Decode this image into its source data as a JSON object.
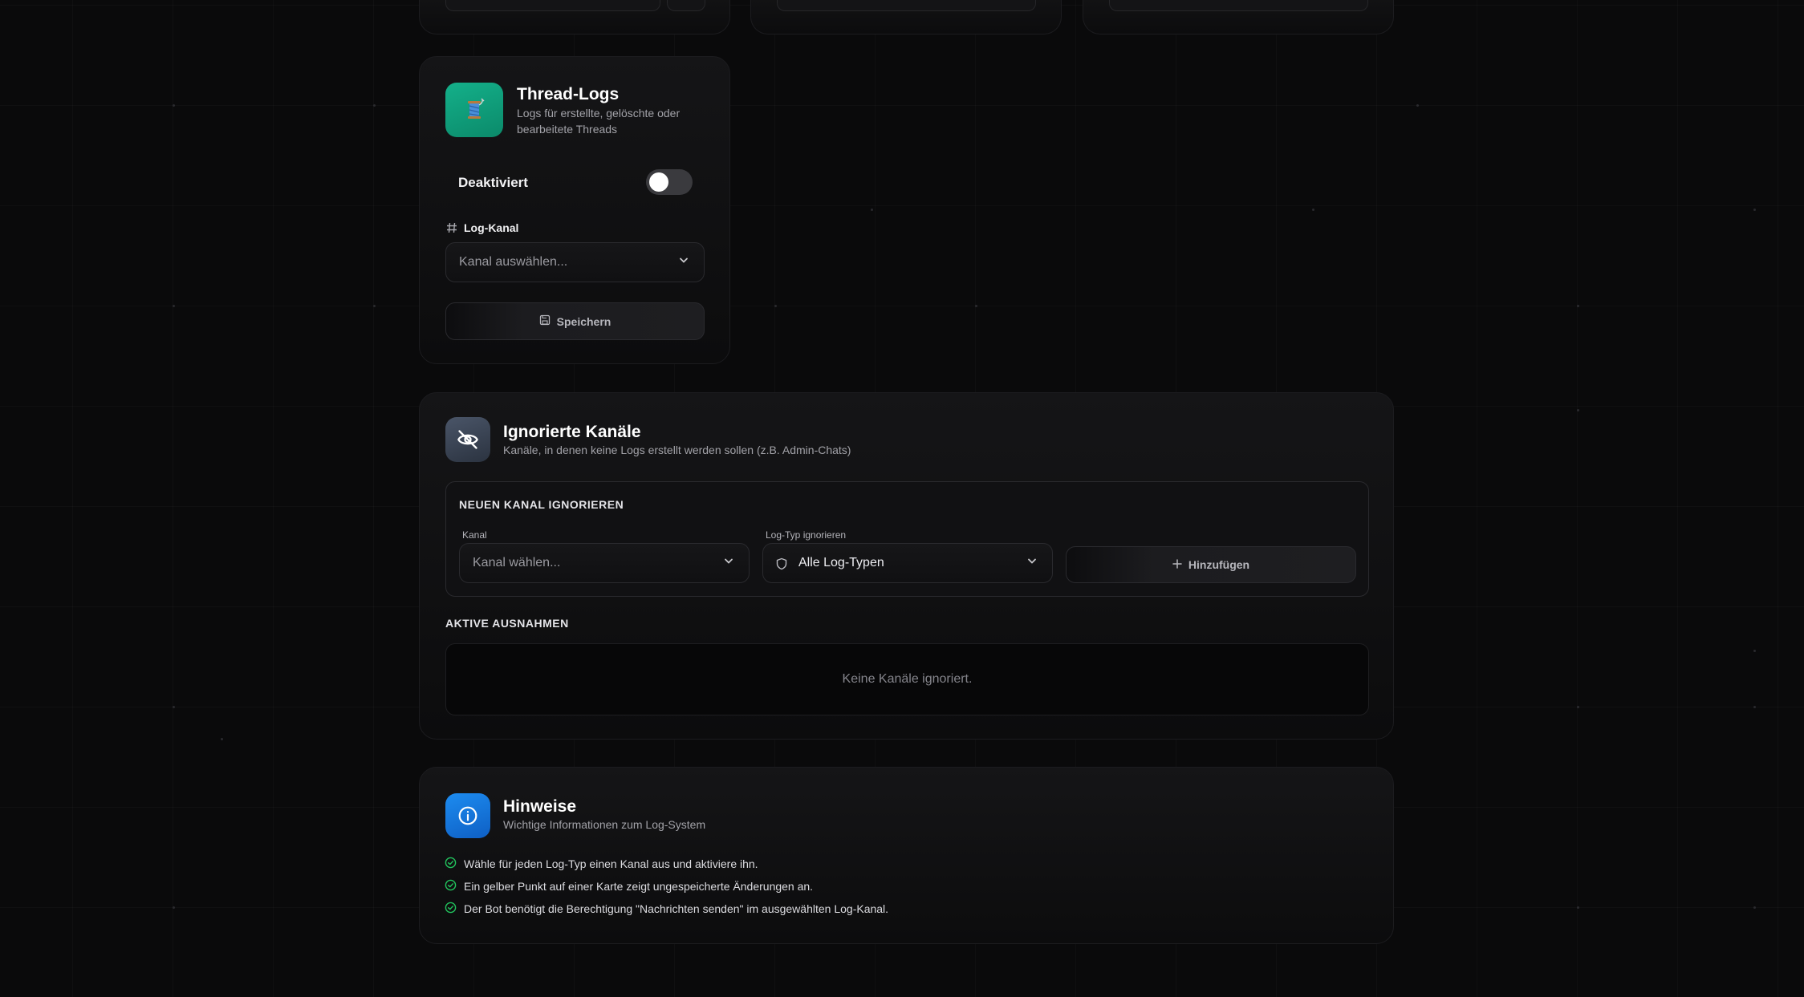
{
  "thread_logs": {
    "title": "Thread-Logs",
    "description": "Logs für erstellte, gelöschte oder bearbeitete Threads",
    "status_label": "Deaktiviert",
    "toggle_on": false,
    "channel_label": "Log-Kanal",
    "channel_placeholder": "Kanal auswählen...",
    "save_label": "Speichern",
    "icon": "spool-of-thread-icon"
  },
  "ignored_channels": {
    "title": "Ignorierte Kanäle",
    "description": "Kanäle, in denen keine Logs erstellt werden sollen (z.B. Admin-Chats)",
    "new_section_title": "NEUEN KANAL IGNORIEREN",
    "channel_label": "Kanal",
    "channel_placeholder": "Kanal wählen...",
    "type_label": "Log-Typ ignorieren",
    "type_value": "Alle Log-Typen",
    "add_label": "Hinzufügen",
    "active_title": "AKTIVE AUSNAHMEN",
    "empty_text": "Keine Kanäle ignoriert.",
    "icon": "eye-off-icon"
  },
  "hints": {
    "title": "Hinweise",
    "description": "Wichtige Informationen zum Log-System",
    "icon": "info-icon",
    "items": [
      "Wähle für jeden Log-Typ einen Kanal aus und aktiviere ihn.",
      "Ein gelber Punkt auf einer Karte zeigt ungespeicherte Änderungen an.",
      "Der Bot benötigt die Berechtigung \"Nachrichten senden\" im ausgewählten Log-Kanal."
    ]
  },
  "colors": {
    "thread_icon_bg": "#0f9a78",
    "ignored_icon_bg": "#3a4556",
    "hints_icon_bg": "#1274e0",
    "check_green": "#22c55e"
  }
}
